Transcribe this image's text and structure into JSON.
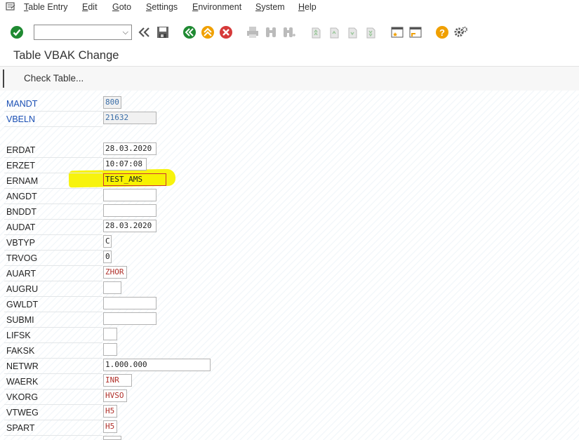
{
  "menubar": {
    "items": [
      {
        "u": "T",
        "rest": "able Entry"
      },
      {
        "u": "E",
        "rest": "dit"
      },
      {
        "u": "G",
        "rest": "oto"
      },
      {
        "u": "S",
        "rest": "ettings"
      },
      {
        "u": "E",
        "rest": "nvironment"
      },
      {
        "u": "S",
        "rest": "ystem"
      },
      {
        "u": "H",
        "rest": "elp"
      }
    ]
  },
  "toolbar": {
    "command_field_value": "",
    "icons": [
      "checkmark-icon",
      "back-double-icon",
      "save-icon",
      "back-icon",
      "exit-icon",
      "cancel-icon",
      "print-icon",
      "find-icon",
      "find-next-icon",
      "first-page-icon",
      "previous-page-icon",
      "next-page-icon",
      "last-page-icon",
      "create-session-icon",
      "shortcut-icon",
      "help-icon",
      "settings-gear-icon"
    ]
  },
  "title": "Table VBAK Change",
  "appbar": {
    "check_table_label": "Check Table..."
  },
  "colors": {
    "accent_green": "#1f8a32",
    "accent_orange": "#f0a000",
    "accent_red": "#d63a3a",
    "key_blue": "#1a4fb4",
    "highlight": "#f7f200"
  },
  "fields": [
    {
      "label": "MANDT",
      "value": "800",
      "key": true
    },
    {
      "label": "VBELN",
      "value": "21632",
      "key": true
    },
    {
      "label": "ERDAT",
      "value": "28.03.2020"
    },
    {
      "label": "ERZET",
      "value": "10:07:08"
    },
    {
      "label": "ERNAM",
      "value": "TEST_AMS",
      "focus": true
    },
    {
      "label": "ANGDT",
      "value": ""
    },
    {
      "label": "BNDDT",
      "value": ""
    },
    {
      "label": "AUDAT",
      "value": "28.03.2020"
    },
    {
      "label": "VBTYP",
      "value": "C"
    },
    {
      "label": "TRVOG",
      "value": "0"
    },
    {
      "label": "AUART",
      "value": "ZHOR",
      "red": true
    },
    {
      "label": "AUGRU",
      "value": ""
    },
    {
      "label": "GWLDT",
      "value": ""
    },
    {
      "label": "SUBMI",
      "value": ""
    },
    {
      "label": "LIFSK",
      "value": ""
    },
    {
      "label": "FAKSK",
      "value": ""
    },
    {
      "label": "NETWR",
      "value": "1.000.000"
    },
    {
      "label": "WAERK",
      "value": "INR",
      "red": true
    },
    {
      "label": "VKORG",
      "value": "HVSO",
      "red": true
    },
    {
      "label": "VTWEG",
      "value": "H5",
      "red": true
    },
    {
      "label": "SPART",
      "value": "H5",
      "red": true
    },
    {
      "label": "",
      "value": ""
    }
  ]
}
